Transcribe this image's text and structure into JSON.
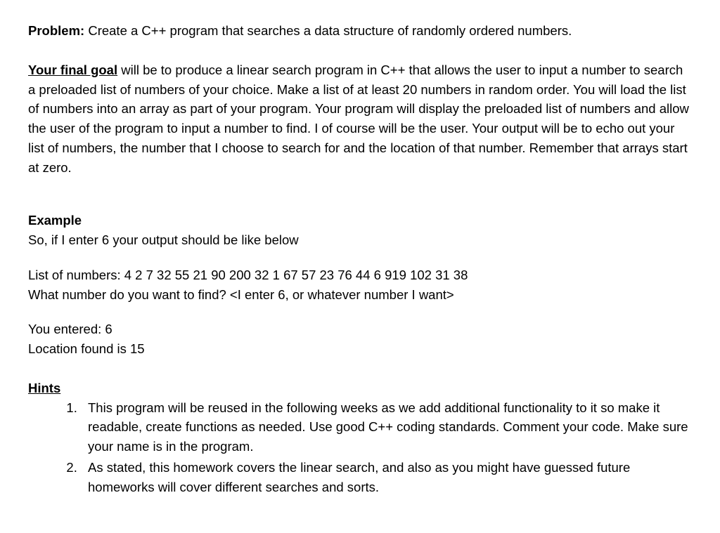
{
  "problem": {
    "label": "Problem:",
    "text": " Create a C++ program that searches a data structure of randomly ordered numbers."
  },
  "goal": {
    "label": "Your final goal",
    "text": " will be to produce a linear search program in C++ that allows the user to input a number to search a preloaded list of numbers of your choice.  Make a list of at least 20 numbers in random order. You will load the list of numbers into an array as part of your program. Your program will display the preloaded list of numbers and allow the user of the program to input a number to find. I of course will be the user. Your output will be to echo out your list of numbers, the number that I choose to search for and the location of that number. Remember that arrays start at zero."
  },
  "example": {
    "heading": "Example",
    "intro": "So, if I enter 6 your output should be like below",
    "listline": "List of numbers: 4 2 7 32 55 21 90 200 32 1 67 57 23 76 44 6 919 102 31 38",
    "prompt": "What number do you want to find? <I enter 6, or whatever number I want>",
    "entered": "You entered: 6",
    "location": "Location found is 15"
  },
  "hints": {
    "heading": "Hints",
    "items": [
      "This program will be reused in the following weeks as we add additional functionality to it so make it readable, create functions as needed. Use good C++ coding standards. Comment your code. Make sure your name is in the program.",
      "As stated, this homework covers the linear search, and also as you might have guessed future homeworks will cover different searches and sorts."
    ]
  }
}
